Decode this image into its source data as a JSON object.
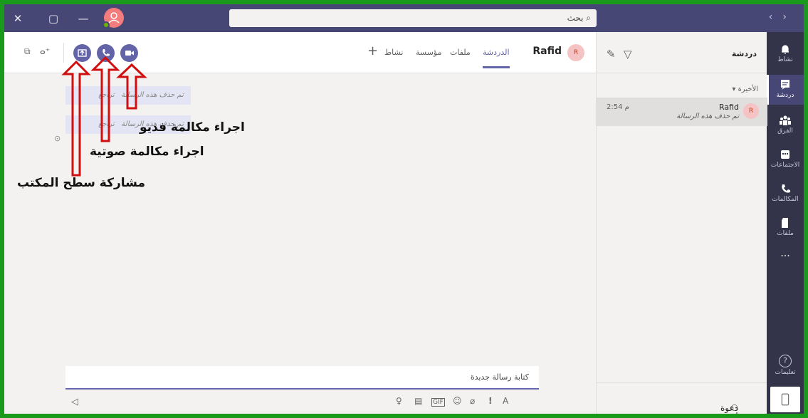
{
  "window": {
    "controls": {
      "close": "✕",
      "restore": "▢",
      "minimize": "—"
    },
    "search_text": "بحث",
    "nav_back": "‹",
    "nav_forward": "›"
  },
  "rail": {
    "items": [
      {
        "label": "نشاط",
        "icon": "bell-icon"
      },
      {
        "label": "دردشة",
        "icon": "chat-icon",
        "active": true
      },
      {
        "label": "الفرق",
        "icon": "teams-icon"
      },
      {
        "label": "الاجتماعات",
        "icon": "calendar-icon"
      },
      {
        "label": "المكالمات",
        "icon": "phone-icon"
      },
      {
        "label": "ملفات",
        "icon": "file-icon"
      }
    ],
    "more": "...",
    "help_label": "تعليمات"
  },
  "chat_list": {
    "title": "دردشة",
    "section": "الأخيرة",
    "items": [
      {
        "name": "Rafid",
        "initial": "R",
        "preview": "تم حذف هذه الرسالة",
        "time": "2:54 م"
      }
    ],
    "invite_label": "دعوة أشخاص"
  },
  "conversation": {
    "peer_name": "Rafid",
    "peer_initial": "R",
    "tabs": [
      "الدردشة",
      "ملفات",
      "مؤسسة",
      "نشاط"
    ],
    "add_tab": "+",
    "messages": [
      {
        "text": "تم حذف هذه الرسالة",
        "action": "تراجع"
      },
      {
        "text": "تم حذف هذه الرسالة",
        "action": "تراجع"
      }
    ],
    "compose_placeholder": "كتابة رسالة جديدة"
  },
  "annotations": {
    "video": "اجراء مكالمة فديو",
    "audio": "اجراء مكالمة صوتية",
    "share": "مشاركة سطح المكتب"
  },
  "colors": {
    "accent": "#6264a7",
    "rail": "#33344a",
    "titlebar": "#464775",
    "frame": "#1a9a1a",
    "arrow": "#d01010"
  }
}
